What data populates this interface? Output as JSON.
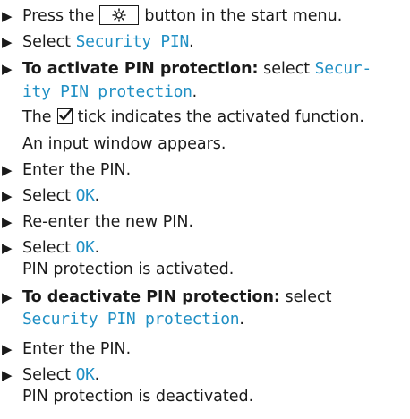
{
  "steps": [
    {
      "pre": "Press the",
      "post": "button in the start menu.",
      "icon": "gear-icon"
    },
    {
      "pre": "Select ",
      "link": "Security PIN",
      "post": "."
    },
    {
      "bold": "To activate PIN protection:",
      "pre": " select ",
      "link": "Secur-"
    },
    {
      "cont_link": "ity PIN protection",
      "post": "."
    },
    {
      "pre": "The",
      "post": "tick indicates the activated function.",
      "icon": "checkbox-tick-icon"
    },
    {
      "text": "An input window appears."
    },
    {
      "text": "Enter the PIN."
    },
    {
      "pre": "Select ",
      "link": "OK",
      "post": "."
    },
    {
      "text": "Re-enter the new PIN."
    },
    {
      "pre": "Select ",
      "link": "OK",
      "post": "."
    },
    {
      "text": "PIN protection is activated."
    },
    {
      "bold": "To deactivate PIN protection:",
      "pre": " select"
    },
    {
      "cont_link": "Security PIN protection",
      "post": "."
    },
    {
      "text": "Enter the PIN."
    },
    {
      "pre": "Select ",
      "link": "OK",
      "post": "."
    },
    {
      "text": "PIN protection is deactivated."
    }
  ]
}
